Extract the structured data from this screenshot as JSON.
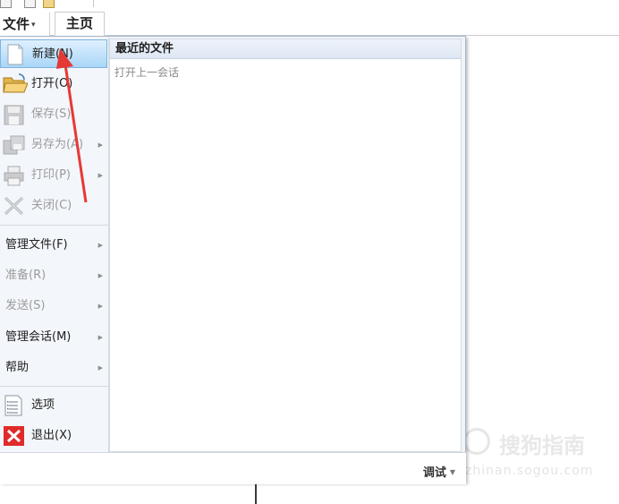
{
  "ribbon": {
    "file_tab": "文件",
    "home_tab": "主页"
  },
  "menu": {
    "items": [
      {
        "label": "新建(N)",
        "icon": "new-document-icon",
        "state": "active"
      },
      {
        "label": "打开(O)",
        "icon": "folder-open-icon",
        "state": "enabled"
      },
      {
        "label": "保存(S)",
        "icon": "save-disk-icon",
        "state": "disabled"
      },
      {
        "label": "另存为(A)",
        "icon": "save-as-icon",
        "state": "disabled",
        "submenu": true
      },
      {
        "label": "打印(P)",
        "icon": "printer-icon",
        "state": "disabled",
        "submenu": true
      },
      {
        "label": "关闭(C)",
        "icon": "close-x-icon",
        "state": "disabled"
      },
      {
        "label": "管理文件(F)",
        "state": "enabled",
        "submenu": true
      },
      {
        "label": "准备(R)",
        "state": "disabled",
        "submenu": true
      },
      {
        "label": "发送(S)",
        "state": "disabled",
        "submenu": true
      },
      {
        "label": "管理会话(M)",
        "state": "enabled",
        "submenu": true
      },
      {
        "label": "帮助",
        "state": "enabled",
        "submenu": true
      },
      {
        "label": "选项",
        "icon": "options-list-icon",
        "state": "enabled"
      },
      {
        "label": "退出(X)",
        "icon": "exit-red-x-icon",
        "state": "enabled"
      }
    ]
  },
  "recent": {
    "header": "最近的文件",
    "items": [
      "打开上一会话"
    ]
  },
  "footer": {
    "debug": "调试"
  },
  "watermark": {
    "brand": "搜狗指南",
    "url": "zhinan.sogou.com"
  },
  "colors": {
    "accent_highlight": "#a9d6f7",
    "annotation_arrow": "#e53935",
    "exit_icon": "#e02b2b"
  }
}
